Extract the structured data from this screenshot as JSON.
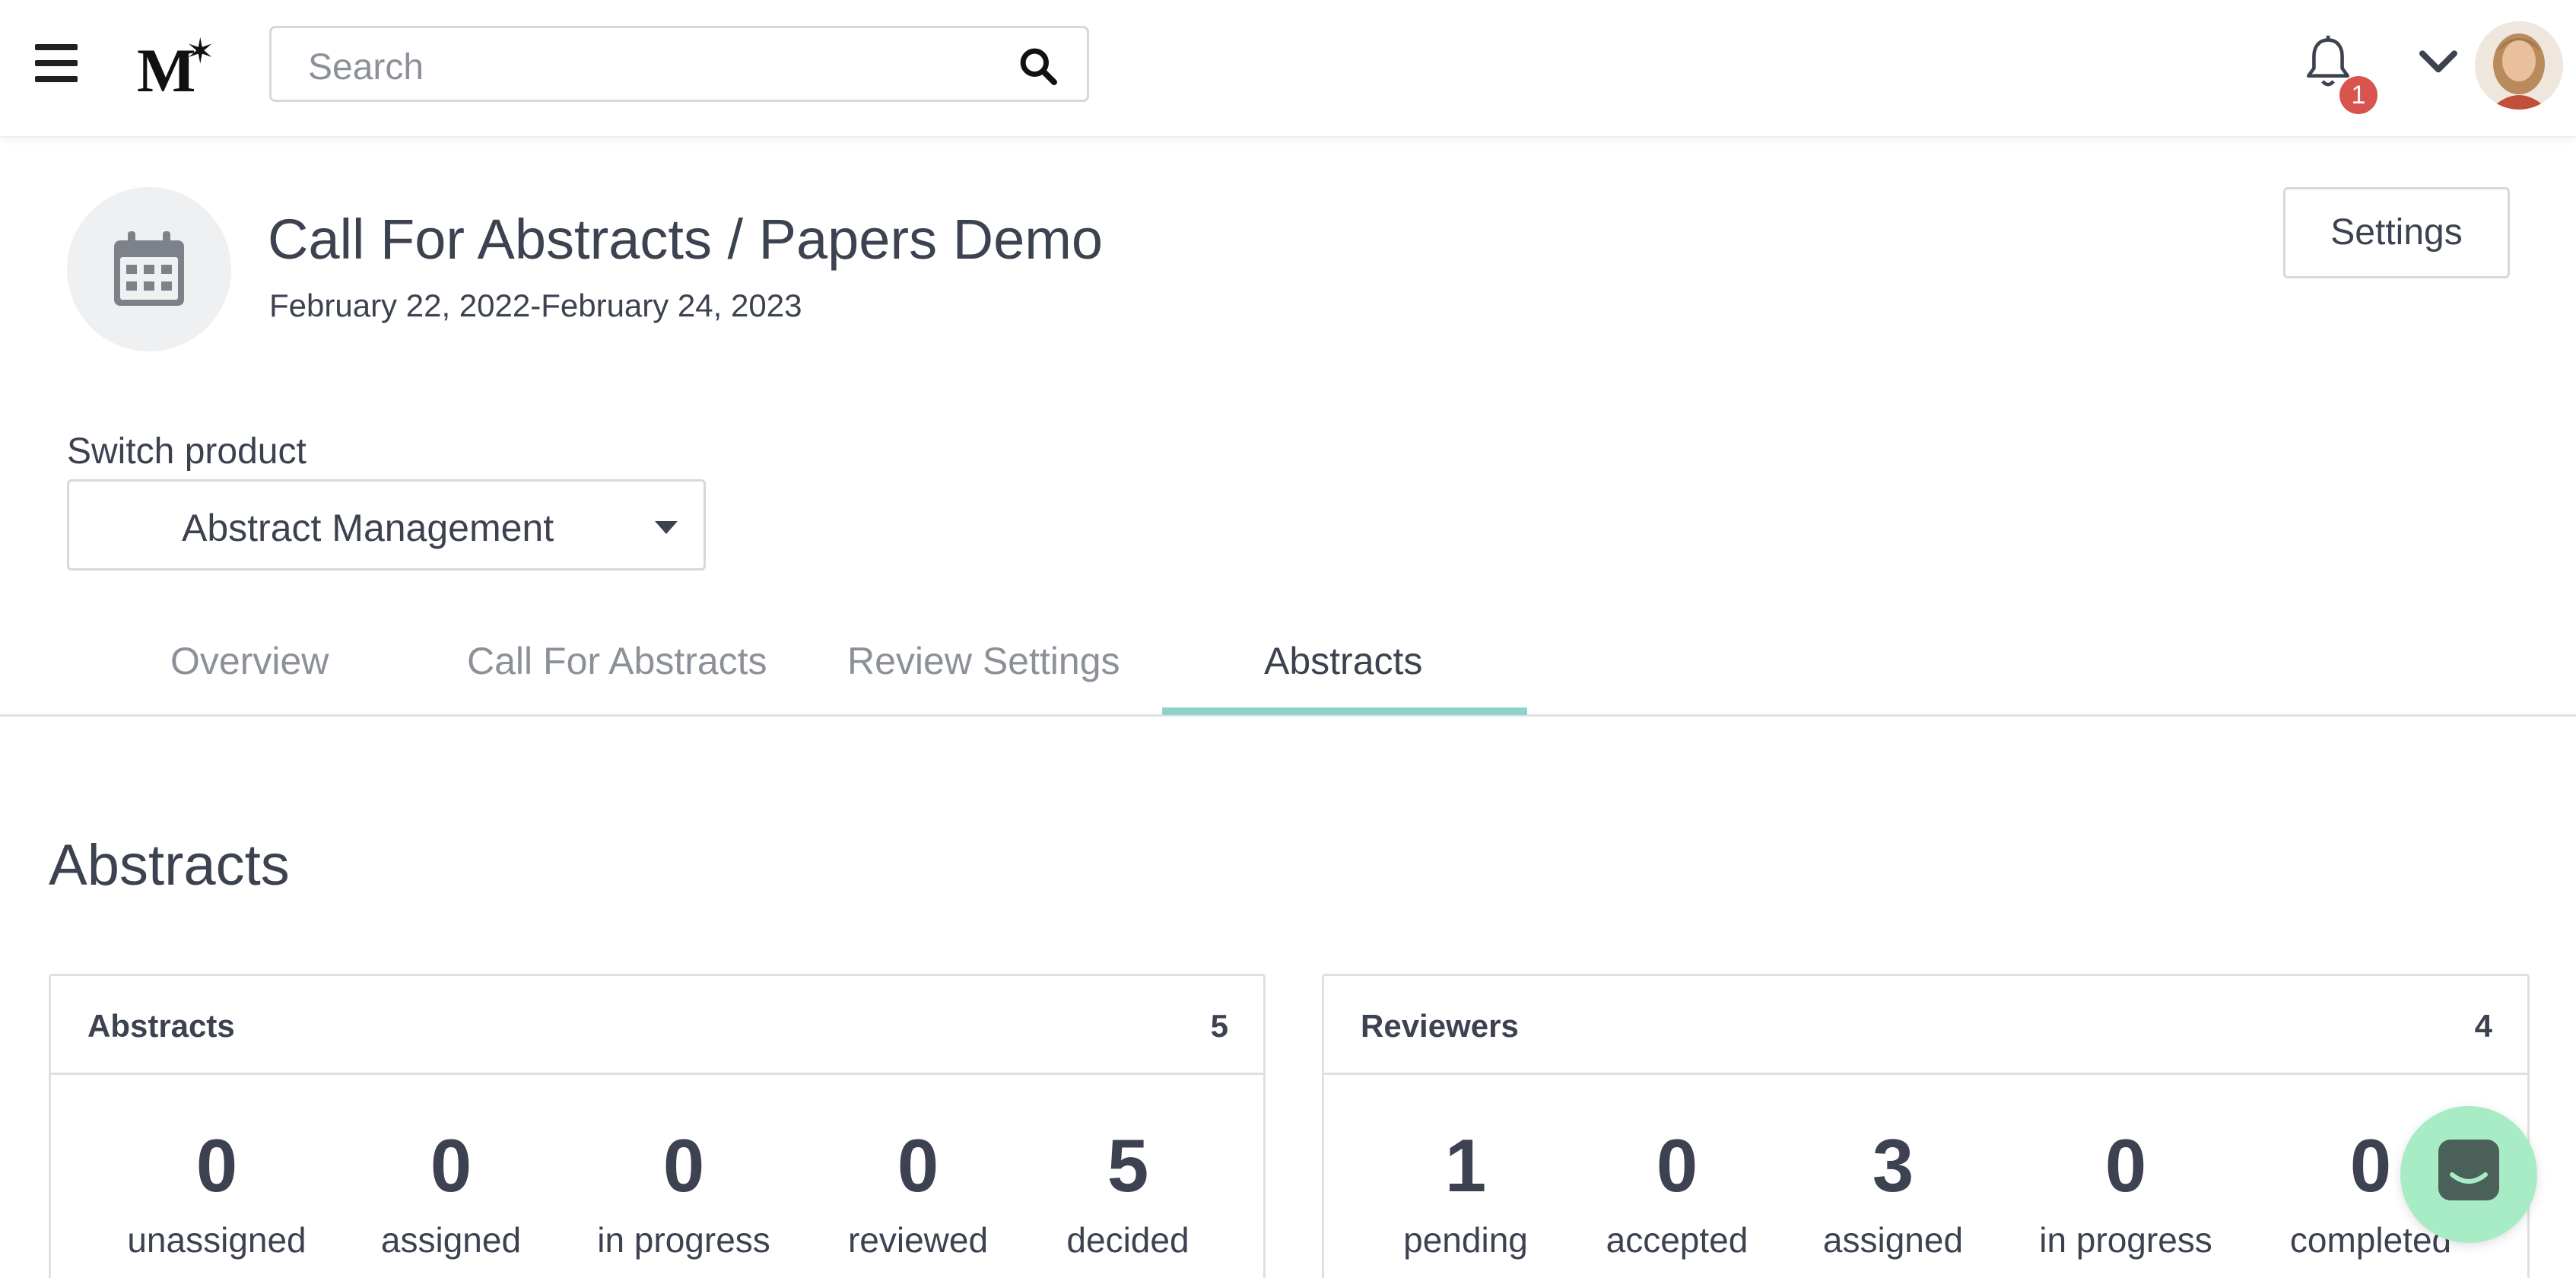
{
  "header": {
    "logo_text": "M",
    "search_placeholder": "Search",
    "notification_count": "1"
  },
  "event": {
    "title": "Call For Abstracts / Papers Demo",
    "dates": "February 22, 2022-February 24, 2023",
    "settings_label": "Settings"
  },
  "switch_product": {
    "label": "Switch product",
    "selected": "Abstract Management"
  },
  "tabs": [
    {
      "label": "Overview",
      "active": false
    },
    {
      "label": "Call For Abstracts",
      "active": false
    },
    {
      "label": "Review Settings",
      "active": false
    },
    {
      "label": "Abstracts",
      "active": true
    }
  ],
  "section_title": "Abstracts",
  "cards": {
    "abstracts": {
      "title": "Abstracts",
      "count": "5",
      "stats": [
        {
          "value": "0",
          "label": "unassigned"
        },
        {
          "value": "0",
          "label": "assigned"
        },
        {
          "value": "0",
          "label": "in progress"
        },
        {
          "value": "0",
          "label": "reviewed"
        },
        {
          "value": "5",
          "label": "decided"
        }
      ]
    },
    "reviewers": {
      "title": "Reviewers",
      "count": "4",
      "stats": [
        {
          "value": "1",
          "label": "pending"
        },
        {
          "value": "0",
          "label": "accepted"
        },
        {
          "value": "3",
          "label": "assigned"
        },
        {
          "value": "0",
          "label": "in progress"
        },
        {
          "value": "0",
          "label": "completed"
        }
      ]
    }
  },
  "colors": {
    "accent_tab_underline": "#8ed3ca",
    "badge": "#d9534f",
    "chat_button": "#a8ecc5",
    "text": "#3d4250",
    "muted_text": "#8c9099"
  },
  "icons": {
    "menu": "hamburger-icon",
    "search": "search-icon",
    "notifications": "bell-icon",
    "account_menu": "chevron-down-icon",
    "event": "calendar-icon",
    "chat": "chat-icon"
  }
}
